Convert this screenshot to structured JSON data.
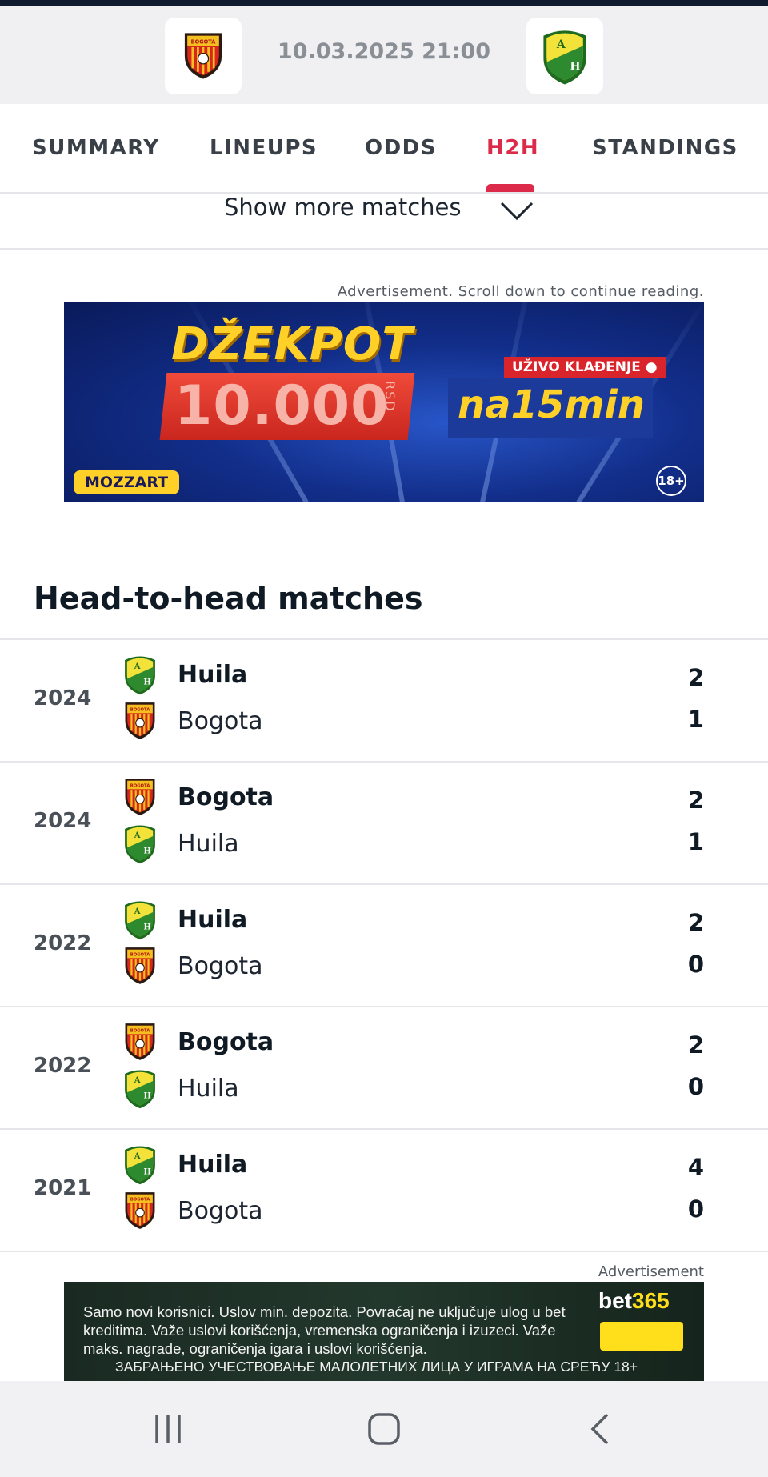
{
  "match": {
    "datetime": "10.03.2025 21:00",
    "home_team": "Bogota",
    "away_team": "Huila"
  },
  "tabs": [
    {
      "label": "SUMMARY",
      "active": false
    },
    {
      "label": "LINEUPS",
      "active": false
    },
    {
      "label": "ODDS",
      "active": false
    },
    {
      "label": "H2H",
      "active": true
    },
    {
      "label": "STANDINGS",
      "active": false
    }
  ],
  "show_more": {
    "label": "Show more matches"
  },
  "ad_top": {
    "note": "Advertisement. Scroll down to continue reading.",
    "headline": "DŽEKPOT",
    "amount": "10.000",
    "currency": "RSD",
    "badge": "UŽIVO KLAĐENJE ●",
    "tagline": "na15min",
    "brand": "MOZZART",
    "age": "18+"
  },
  "h2h": {
    "title": "Head-to-head matches",
    "matches": [
      {
        "year": "2024",
        "team1": "Huila",
        "team1_logo": "huila",
        "score1": "2",
        "team2": "Bogota",
        "team2_logo": "bogota",
        "score2": "1"
      },
      {
        "year": "2024",
        "team1": "Bogota",
        "team1_logo": "bogota",
        "score1": "2",
        "team2": "Huila",
        "team2_logo": "huila",
        "score2": "1"
      },
      {
        "year": "2022",
        "team1": "Huila",
        "team1_logo": "huila",
        "score1": "2",
        "team2": "Bogota",
        "team2_logo": "bogota",
        "score2": "0"
      },
      {
        "year": "2022",
        "team1": "Bogota",
        "team1_logo": "bogota",
        "score1": "2",
        "team2": "Huila",
        "team2_logo": "huila",
        "score2": "0"
      },
      {
        "year": "2021",
        "team1": "Huila",
        "team1_logo": "huila",
        "score1": "4",
        "team2": "Bogota",
        "team2_logo": "bogota",
        "score2": "0"
      }
    ]
  },
  "ad_bottom": {
    "note": "Advertisement",
    "text": "Samo novi korisnici. Uslov min. depozita. Povraćaj ne uključuje ulog u bet kreditima. Važe uslovi korišćenja, vremenska ograničenja i izuzeci. Važe maks. nagrade, ograničenja igara i uslovi korišćenja.",
    "cyrillic": "ЗАБРАЊЕНО УЧЕСТВОВАЊЕ МАЛОЛЕТНИХ ЛИЦА У ИГРАМА НА СРЕЋУ 18+",
    "brand_a": "bet",
    "brand_b": "365"
  },
  "nav": {
    "icons": [
      "recent-apps-icon",
      "home-icon",
      "back-icon"
    ]
  },
  "colors": {
    "accent": "#dc2a4a",
    "bogota_red": "#d8261e",
    "huila_green": "#2e8a2e",
    "huila_yellow": "#f2e23a"
  }
}
